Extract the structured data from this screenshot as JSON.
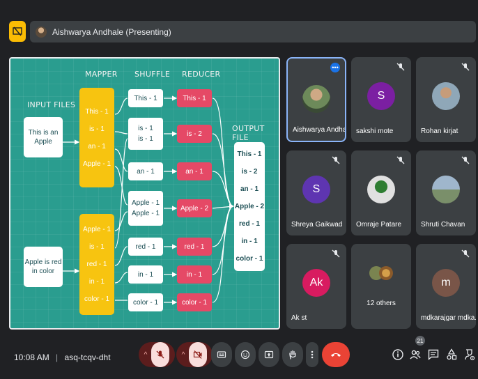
{
  "topbar": {
    "presenter_label": "Aishwarya Andhale (Presenting)"
  },
  "slide": {
    "headers": {
      "mapper": "MAPPER",
      "shuffle": "SHUFFLE",
      "reducer": "REDUCER",
      "input_files": "INPUT FILES",
      "output_file": "OUTPUT FILE"
    },
    "input_1": [
      "This is an",
      "Apple"
    ],
    "input_2": [
      "Apple is red",
      "in color"
    ],
    "mapper_1": [
      "This - 1",
      "is - 1",
      "an - 1",
      "Apple - 1"
    ],
    "mapper_2": [
      "Apple - 1",
      "is - 1",
      "red - 1",
      "in - 1",
      "color - 1"
    ],
    "shuffle": [
      [
        "This - 1"
      ],
      [
        "is - 1",
        "is - 1"
      ],
      [
        "an - 1"
      ],
      [
        "Apple - 1",
        "Apple - 1"
      ],
      [
        "red - 1"
      ],
      [
        "in - 1"
      ],
      [
        "color - 1"
      ]
    ],
    "reducer": [
      "This - 1",
      "is - 2",
      "an - 1",
      "Apple - 2",
      "red - 1",
      "in - 1",
      "color - 1"
    ],
    "output": [
      "This - 1",
      "is - 2",
      "an - 1",
      "Apple - 2",
      "red - 1",
      "in - 1",
      "color - 1"
    ]
  },
  "participants": [
    {
      "name": "Aishwarya Andhale",
      "type": "photo",
      "selected": true
    },
    {
      "name": "sakshi mote",
      "type": "letter",
      "letter": "S",
      "color": "#7b1fa2"
    },
    {
      "name": "Rohan kirjat",
      "type": "photo"
    },
    {
      "name": "Shreya Gaikwad",
      "type": "letter",
      "letter": "S",
      "color": "#5e35b1"
    },
    {
      "name": "Omraje Patare",
      "type": "photo"
    },
    {
      "name": "Shruti Chavan",
      "type": "photo"
    },
    {
      "name": "Ak st",
      "type": "letter",
      "letter": "Ak",
      "color": "#d81b60"
    },
    {
      "name": "12 others",
      "type": "group"
    },
    {
      "name": "mdkarajgar mdka...",
      "type": "letter",
      "letter": "m",
      "color": "#795548"
    }
  ],
  "bottombar": {
    "time": "10:08 AM",
    "meeting_code": "asq-tcqv-dht",
    "participant_count": "21"
  }
}
